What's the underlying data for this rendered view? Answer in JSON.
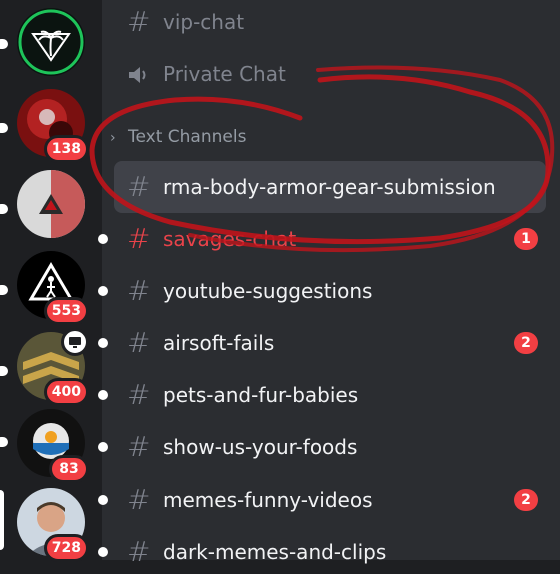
{
  "servers": [
    {
      "name": "palm-tree-server",
      "badge": null
    },
    {
      "name": "red-server",
      "badge": "138"
    },
    {
      "name": "triangle-logo-server",
      "badge": null
    },
    {
      "name": "warning-sign-server",
      "badge": "553"
    },
    {
      "name": "chevron-patch-server",
      "badge": "400"
    },
    {
      "name": "blue-emblem-server",
      "badge": "83"
    },
    {
      "name": "profile-photo-server",
      "badge": "728"
    }
  ],
  "channels": {
    "vip_chat": "vip-chat",
    "private_chat": "Private Chat",
    "category": "Text Channels",
    "rma": "rma-body-armor-gear-submission",
    "savages": "savages-chat",
    "savages_count": "1",
    "youtube": "youtube-suggestions",
    "airsoft": "airsoft-fails",
    "airsoft_count": "2",
    "pets": "pets-and-fur-babies",
    "foods": "show-us-your-foods",
    "memes": "memes-funny-videos",
    "memes_count": "2",
    "dark": "dark-memes-and-clips"
  },
  "colors": {
    "rail_bg": "#1e1f22",
    "channel_bg": "#2b2d31",
    "selected_bg": "#404249",
    "badge_red": "#f23f43",
    "annotation_red": "#c0141b"
  }
}
